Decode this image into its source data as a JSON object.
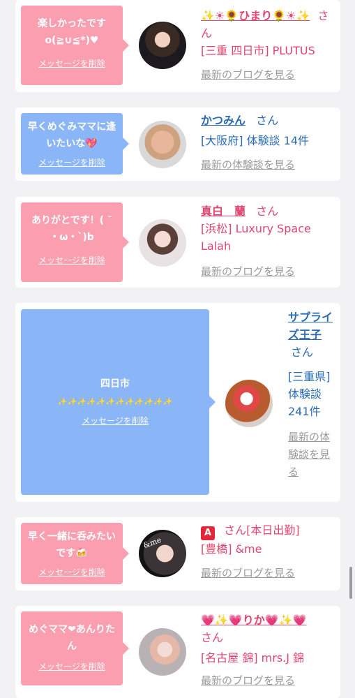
{
  "common": {
    "delete_label": "メッセージを削除",
    "latest_blog": "最新のブログを見る",
    "latest_review": "最新の体験談を見る",
    "san": "さん"
  },
  "cards": [
    {
      "message": "楽しかったです o(≧∪≦*)♥",
      "name": "✨☀🌻ひまり🌻☀✨",
      "shop": "[三重 四日市] PLUTUS"
    },
    {
      "message": "早くめぐみママに逢いたいな💖",
      "name": "かつみん",
      "shop": "[大阪府] 体験談 14件"
    },
    {
      "message": "ありがとです！( ˘ ・ω・ˋ)b",
      "name": "真白　蘭",
      "shop": "[浜松] Luxury Space Lalah"
    },
    {
      "message_line1": "四日市",
      "message_line2": "✨✨✨✨✨✨✨✨✨✨✨✨",
      "name": "サプライズ王子",
      "shop": "[三重県] 体験談 241件"
    },
    {
      "message": "早く一緒に呑みたいです🍻",
      "badge": "A",
      "name_suffix": "さん[本日出勤]",
      "shop": "[豊橋] &me",
      "avatar_text": "&me"
    },
    {
      "message": "めぐママ❤あんりたん",
      "name": "💗✨💗りか💗✨💗",
      "shop": "[名古屋 錦] mrs.J 錦"
    }
  ]
}
